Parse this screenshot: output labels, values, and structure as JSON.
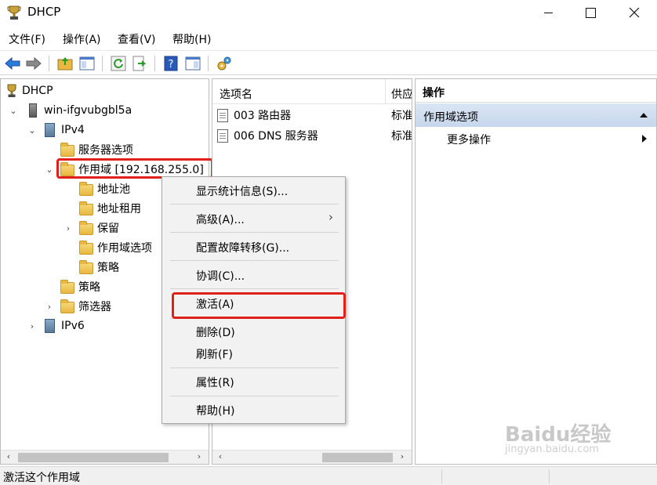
{
  "window": {
    "title": "DHCP"
  },
  "menubar": {
    "items": [
      "文件(F)",
      "操作(A)",
      "查看(V)",
      "帮助(H)"
    ]
  },
  "tree": {
    "root": "DHCP",
    "server": "win-ifgvubgbl5a",
    "ipv4": "IPv4",
    "server_options": "服务器选项",
    "scope": "作用域 [192.168.255.0]",
    "address_pool": "地址池",
    "address_leases": "地址租用",
    "reservations": "保留",
    "scope_options": "作用域选项",
    "policies_sub": "策略",
    "policies": "策略",
    "filters": "筛选器",
    "ipv6": "IPv6"
  },
  "list": {
    "columns": [
      "选项名",
      "供应"
    ],
    "rows": [
      {
        "name": "003 路由器",
        "vendor": "标准"
      },
      {
        "name": "006 DNS 服务器",
        "vendor": "标准"
      }
    ]
  },
  "actions": {
    "header": "操作",
    "section": "作用域选项",
    "more": "更多操作"
  },
  "context_menu": {
    "items": [
      "显示统计信息(S)...",
      "高级(A)...",
      "配置故障转移(G)...",
      "协调(C)...",
      "激活(A)",
      "删除(D)",
      "刷新(F)",
      "属性(R)",
      "帮助(H)"
    ]
  },
  "status": {
    "text": "激活这个作用域"
  },
  "watermark": {
    "brand": "Baidu经验",
    "url": "jingyan.baidu.com"
  },
  "colors": {
    "highlight": "#e0201a",
    "action_section": "#c6d6ec"
  }
}
